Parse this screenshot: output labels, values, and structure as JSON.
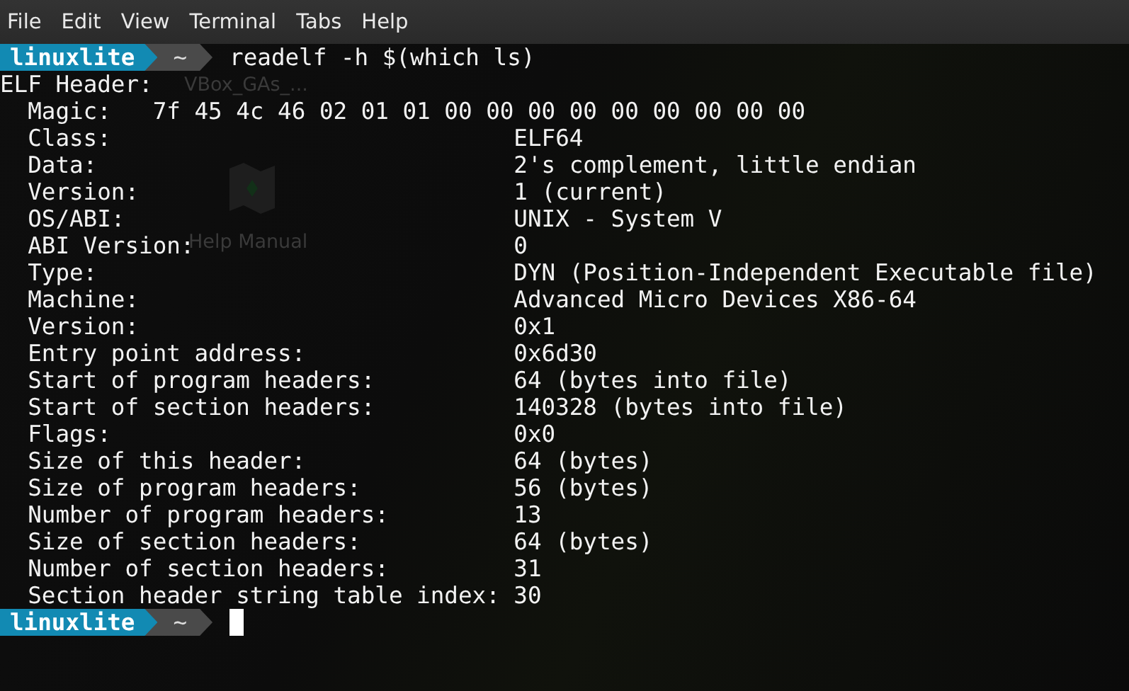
{
  "menu": [
    {
      "label": "File"
    },
    {
      "label": "Edit"
    },
    {
      "label": "View"
    },
    {
      "label": "Terminal"
    },
    {
      "label": "Tabs"
    },
    {
      "label": "Help"
    }
  ],
  "desktop_labels": [
    {
      "text": "VBox_GAs_...",
      "kind": "disc"
    },
    {
      "text": "Help Manual",
      "kind": "help"
    }
  ],
  "terminal": {
    "lines": [
      {
        "kind": "prompt",
        "user": "linuxlite",
        "dir": "~",
        "command": "readelf -h $(which ls)",
        "cursor": false
      },
      {
        "kind": "heading",
        "text": "ELF Header:"
      },
      {
        "kind": "field-inline",
        "label": "Magic:",
        "value": "7f 45 4c 46 02 01 01 00 00 00 00 00 00 00 00 00"
      },
      {
        "kind": "field",
        "label": "Class:",
        "value": "ELF64"
      },
      {
        "kind": "field",
        "label": "Data:",
        "value": "2's complement, little endian"
      },
      {
        "kind": "field",
        "label": "Version:",
        "value": "1 (current)"
      },
      {
        "kind": "field",
        "label": "OS/ABI:",
        "value": "UNIX - System V"
      },
      {
        "kind": "field",
        "label": "ABI Version:",
        "value": "0"
      },
      {
        "kind": "field",
        "label": "Type:",
        "value": "DYN (Position-Independent Executable file)"
      },
      {
        "kind": "field",
        "label": "Machine:",
        "value": "Advanced Micro Devices X86-64"
      },
      {
        "kind": "field",
        "label": "Version:",
        "value": "0x1"
      },
      {
        "kind": "field",
        "label": "Entry point address:",
        "value": "0x6d30"
      },
      {
        "kind": "field",
        "label": "Start of program headers:",
        "value": "64 (bytes into file)"
      },
      {
        "kind": "field",
        "label": "Start of section headers:",
        "value": "140328 (bytes into file)"
      },
      {
        "kind": "field",
        "label": "Flags:",
        "value": "0x0"
      },
      {
        "kind": "field",
        "label": "Size of this header:",
        "value": "64 (bytes)"
      },
      {
        "kind": "field",
        "label": "Size of program headers:",
        "value": "56 (bytes)"
      },
      {
        "kind": "field",
        "label": "Number of program headers:",
        "value": "13"
      },
      {
        "kind": "field",
        "label": "Size of section headers:",
        "value": "64 (bytes)"
      },
      {
        "kind": "field",
        "label": "Number of section headers:",
        "value": "31"
      },
      {
        "kind": "field",
        "label": "Section header string table index:",
        "value": "30"
      },
      {
        "kind": "prompt",
        "user": "linuxlite",
        "dir": "~",
        "cursor": true
      }
    ]
  }
}
